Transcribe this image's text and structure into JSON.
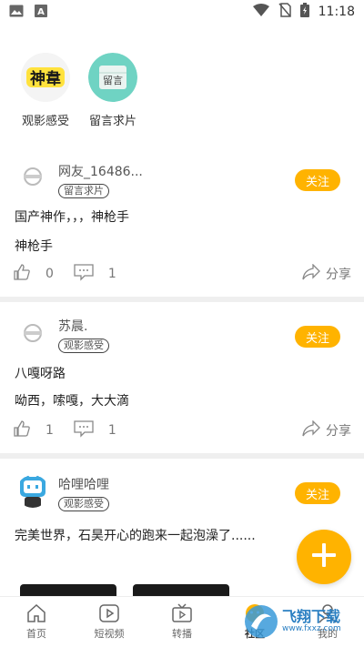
{
  "status_bar": {
    "time": "11:18",
    "icons": [
      "image-icon",
      "a-badge-icon",
      "wifi-icon",
      "no-sim-icon",
      "battery-icon"
    ]
  },
  "categories": [
    {
      "label": "观影感受",
      "art_text": "神韋",
      "icon": "shen-zhang-icon"
    },
    {
      "label": "留言求片",
      "art_text": "留言",
      "icon": "notebook-icon"
    }
  ],
  "posts": [
    {
      "username": "网友_16486...",
      "tag": "留言求片",
      "follow": "关注",
      "text1": "国产神作，，，神枪手",
      "text2": "神枪手",
      "likes": "0",
      "comments": "1",
      "share": "分享"
    },
    {
      "username": "苏晨.",
      "tag": "观影感受",
      "follow": "关注",
      "text1": "八嘎呀路",
      "text2": "呦西，嗦嘎，大大滴",
      "likes": "1",
      "comments": "1",
      "share": "分享"
    },
    {
      "username": "哈哩哈哩",
      "tag": "观影感受",
      "follow": "关注",
      "text1": "完美世界，石昊开心的跑来一起泡澡了......"
    }
  ],
  "nav": [
    {
      "label": "首页",
      "icon": "home-icon"
    },
    {
      "label": "短视频",
      "icon": "play-square-icon"
    },
    {
      "label": "转播",
      "icon": "tv-play-icon"
    },
    {
      "label": "社区",
      "icon": "community-icon"
    },
    {
      "label": "我的",
      "icon": "profile-icon"
    }
  ],
  "watermark": {
    "text": "飞翔下载",
    "sub": "www.fxxz.com"
  },
  "colors": {
    "accent": "#ffb300",
    "divider": "#efefef"
  }
}
